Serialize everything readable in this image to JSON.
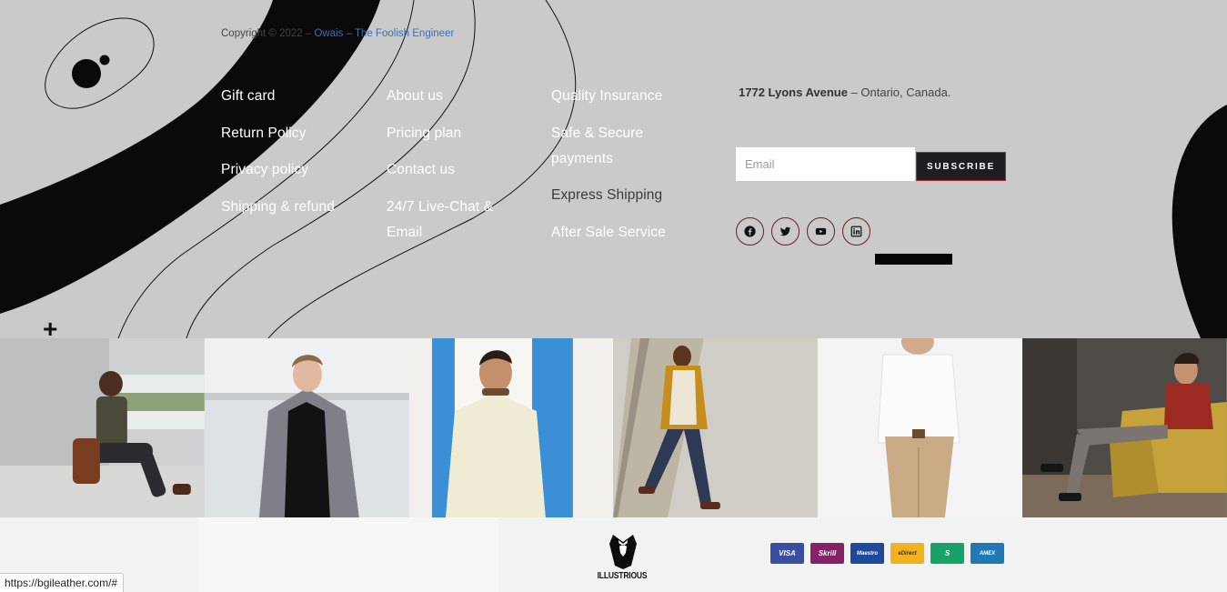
{
  "links": {
    "col1": [
      "Gift card",
      "Return Policy",
      "Privacy policy",
      "Shipping & refund"
    ],
    "col2": [
      "About us",
      "Pricing plan",
      "Contact us",
      "24/7 Live-Chat & Email"
    ],
    "col3": [
      {
        "label": "Quality Insurance",
        "dark": false
      },
      {
        "label": "Safe & Secure payments",
        "dark": false
      },
      {
        "label": "Express Shipping",
        "dark": true
      },
      {
        "label": "After Sale Service",
        "dark": false
      }
    ]
  },
  "address": {
    "street": "1772 Lyons Avenue",
    "rest": " – Ontario, Canada."
  },
  "newsletter": {
    "email_placeholder": "Email",
    "subscribe_label": "SUBSCRIBE"
  },
  "socials": [
    "facebook-icon",
    "twitter-icon",
    "youtube-icon",
    "linkedin-icon"
  ],
  "plus_glyph": "+",
  "gallery": [
    {
      "name": "photo-man-with-bag"
    },
    {
      "name": "photo-man-grey-jacket"
    },
    {
      "name": "photo-man-smiling-blue-wall"
    },
    {
      "name": "photo-man-walking-yellow-jacket"
    },
    {
      "name": "photo-man-white-shirt"
    },
    {
      "name": "photo-man-on-yellow-sofa"
    }
  ],
  "footer": {
    "copyright_prefix": "Copyright © 2022 – ",
    "copyright_link": "Owais – The Foolish Engineer",
    "brand_name": "ILLUSTRIOUS"
  },
  "payments": [
    {
      "label": "VISA",
      "color": "#3a4fa0"
    },
    {
      "label": "Skrill",
      "color": "#862165"
    },
    {
      "label": "Maestro",
      "color": "#1f4a9c"
    },
    {
      "label": "eDirect",
      "color": "#f0b221"
    },
    {
      "label": "S",
      "color": "#1aa06b"
    },
    {
      "label": "AMEX",
      "color": "#2277b5"
    }
  ],
  "status_bar": {
    "url": "https://bgileather.com/#"
  }
}
